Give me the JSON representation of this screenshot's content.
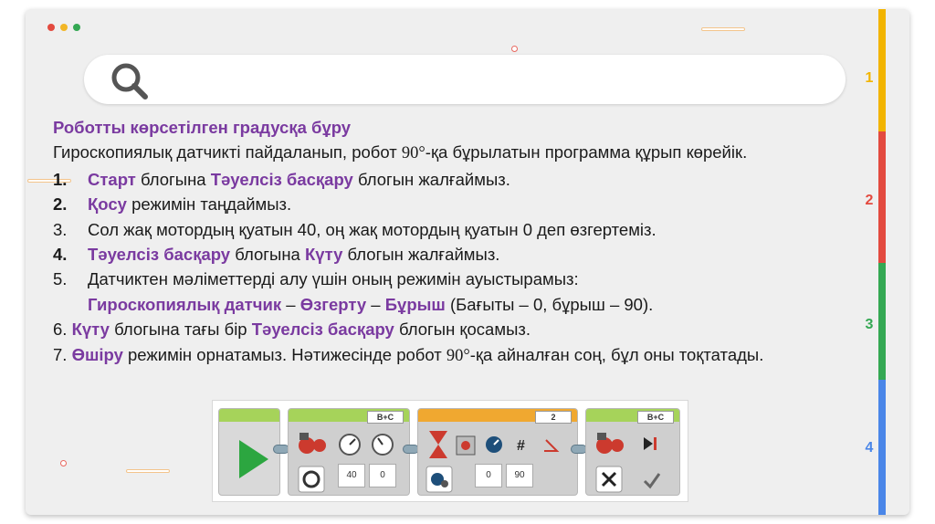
{
  "colors": {
    "accent_purple": "#7a3aa0",
    "dot_red": "#e34a3f",
    "dot_yellow": "#f2b626",
    "dot_green": "#34a853",
    "sidebar_yellow": "#f2b400",
    "sidebar_red": "#e34a3f",
    "sidebar_green": "#34a853",
    "sidebar_blue": "#4a86e8"
  },
  "search": {
    "icon": "search-icon"
  },
  "sidebar": {
    "sections": [
      "1",
      "2",
      "3",
      "4"
    ]
  },
  "content": {
    "title": "Роботты көрсетілген градусқа бұру",
    "intro_1": "Гироскопиялық датчикті пайдаланып, робот ",
    "intro_deg": "90°",
    "intro_2": "-қа бұрылатын программа құрып көрейік.",
    "step1": {
      "num": "1.",
      "hl1": "Старт",
      "t1": " блогына ",
      "hl2": "Тәуелсіз басқару",
      "t2": " блогын жалғаймыз."
    },
    "step2": {
      "num": "2.",
      "hl1": "Қосу",
      "t1": " режимін таңдаймыз."
    },
    "step3": {
      "num": "3.",
      "t1": "Сол жақ мотордың қуатын 40, оң жақ мотордың қуатын 0 деп өзгертеміз."
    },
    "step4": {
      "num": "4.",
      "hl1": "Тәуелсіз басқару",
      "t1": " блогына ",
      "hl2": "Күту",
      "t2": " блогын жалғаймыз."
    },
    "step5": {
      "num": "5.",
      "t1": "Датчиктен мәліметтерді алу үшін оның режимін ауыстырамыз:",
      "hl1": "Гироскопиялық датчик",
      "sep1": " – ",
      "hl2": "Өзгерту",
      "sep2": " – ",
      "hl3": "Бұрыш",
      "t2": " (Бағыты – 0, бұрыш – 90)."
    },
    "step6": {
      "num": "6. ",
      "hl1": "Күту",
      "t1": " блогына тағы бір ",
      "hl2": "Тәуелсіз басқару",
      "t2": " блогын қосамыз."
    },
    "step7": {
      "num": "7. ",
      "hl1": "Өшіру",
      "t1": " режимін орнатамыз. Нәтижесінде робот ",
      "deg": "90°",
      "t2": "-қа айналған соң, бұл оны тоқтатады."
    }
  },
  "program": {
    "block1": {
      "port": "B+C",
      "left_power": "40",
      "right_power": "0"
    },
    "block2": {
      "port": "2",
      "direction": "0",
      "angle": "90"
    },
    "block3": {
      "port": "B+C"
    }
  }
}
